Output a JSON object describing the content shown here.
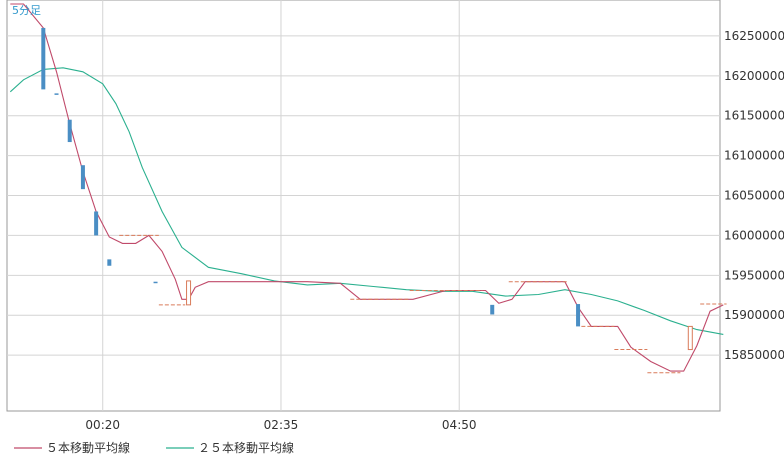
{
  "chart_data": {
    "type": "candlestick",
    "timeframe_label": "5分足",
    "y_ticks": [
      15850000,
      15900000,
      15950000,
      16000000,
      16050000,
      16100000,
      16150000,
      16200000,
      16250000
    ],
    "y_tick_labels": [
      "15850000",
      "15900000",
      "15950000",
      "16000000",
      "16050000",
      "16100000",
      "16150000",
      "16200000",
      "16250000"
    ],
    "ylim": [
      15780000,
      16295000
    ],
    "x_tick_labels": [
      "00:20",
      "02:35",
      "04:50"
    ],
    "x_tick_index": [
      14,
      41,
      68
    ],
    "bar_count": 108,
    "grid": true,
    "colors": {
      "down": "#4a8ec4",
      "up": "#d97b5a",
      "ma5": "#c04a6a",
      "ma25": "#2bb08f",
      "grid": "#d4d4d4",
      "axis": "#999999"
    },
    "candles": [
      {
        "i": 5,
        "open": 16260000,
        "high": 16260000,
        "close": 16183000,
        "low": 16183000
      },
      {
        "i": 7,
        "open": 16178000,
        "high": 16178000,
        "close": 16178000,
        "low": 16178000
      },
      {
        "i": 9,
        "open": 16145000,
        "high": 16145000,
        "close": 16117000,
        "low": 16117000
      },
      {
        "i": 11,
        "open": 16088000,
        "high": 16088000,
        "close": 16058000,
        "low": 16058000
      },
      {
        "i": 13,
        "open": 16030000,
        "high": 16030000,
        "close": 16000000,
        "low": 16000000
      },
      {
        "i": 15,
        "open": 15970000,
        "high": 15970000,
        "close": 15962000,
        "low": 15962000
      },
      {
        "i": 22,
        "open": 15942000,
        "high": 15942000,
        "close": 15942000,
        "low": 15942000
      },
      {
        "i": 27,
        "open": 15913000,
        "high": 15943000,
        "close": 15943000,
        "low": 15913000
      },
      {
        "i": 73,
        "open": 15913000,
        "high": 15913000,
        "close": 15901000,
        "low": 15901000
      },
      {
        "i": 86,
        "open": 15914000,
        "high": 15914000,
        "close": 15886000,
        "low": 15886000
      },
      {
        "i": 103,
        "open": 15857000,
        "high": 15886000,
        "close": 15886000,
        "low": 15857000
      }
    ],
    "flat_bars": [
      {
        "start": 17,
        "end": 22,
        "value": 16000000
      },
      {
        "start": 23,
        "end": 26,
        "value": 15913000
      },
      {
        "start": 52,
        "end": 60,
        "value": 15920000
      },
      {
        "start": 61,
        "end": 71,
        "value": 15931000
      },
      {
        "start": 76,
        "end": 84,
        "value": 15942000
      },
      {
        "start": 87,
        "end": 91,
        "value": 15886000
      },
      {
        "start": 92,
        "end": 96,
        "value": 15857000
      },
      {
        "start": 97,
        "end": 101,
        "value": 15828000
      },
      {
        "start": 105,
        "end": 108,
        "value": 15914000
      }
    ],
    "series": [
      {
        "name": "５本移動平均線",
        "points": [
          [
            0,
            16290000
          ],
          [
            2,
            16290000
          ],
          [
            5,
            16260000
          ],
          [
            7,
            16205000
          ],
          [
            9,
            16140000
          ],
          [
            11,
            16080000
          ],
          [
            13,
            16030000
          ],
          [
            15,
            15998000
          ],
          [
            17,
            15990000
          ],
          [
            19,
            15990000
          ],
          [
            21,
            16000000
          ],
          [
            23,
            15980000
          ],
          [
            25,
            15945000
          ],
          [
            26,
            15920000
          ],
          [
            27,
            15920000
          ],
          [
            28,
            15935000
          ],
          [
            30,
            15942000
          ],
          [
            45,
            15942000
          ],
          [
            50,
            15940000
          ],
          [
            53,
            15920000
          ],
          [
            55,
            15920000
          ],
          [
            58,
            15920000
          ],
          [
            61,
            15920000
          ],
          [
            66,
            15931000
          ],
          [
            72,
            15931000
          ],
          [
            74,
            15915000
          ],
          [
            76,
            15920000
          ],
          [
            78,
            15942000
          ],
          [
            84,
            15942000
          ],
          [
            86,
            15910000
          ],
          [
            88,
            15886000
          ],
          [
            92,
            15886000
          ],
          [
            94,
            15860000
          ],
          [
            97,
            15842000
          ],
          [
            100,
            15830000
          ],
          [
            102,
            15830000
          ],
          [
            104,
            15862000
          ],
          [
            106,
            15905000
          ],
          [
            108,
            15913000
          ]
        ]
      },
      {
        "name": "２５本移動平均線",
        "points": [
          [
            0,
            16180000
          ],
          [
            2,
            16195000
          ],
          [
            5,
            16208000
          ],
          [
            8,
            16210000
          ],
          [
            11,
            16205000
          ],
          [
            14,
            16190000
          ],
          [
            16,
            16165000
          ],
          [
            18,
            16130000
          ],
          [
            20,
            16085000
          ],
          [
            23,
            16030000
          ],
          [
            26,
            15985000
          ],
          [
            30,
            15960000
          ],
          [
            35,
            15952000
          ],
          [
            40,
            15943000
          ],
          [
            45,
            15938000
          ],
          [
            50,
            15940000
          ],
          [
            55,
            15936000
          ],
          [
            60,
            15932000
          ],
          [
            65,
            15930000
          ],
          [
            70,
            15930000
          ],
          [
            75,
            15924000
          ],
          [
            80,
            15926000
          ],
          [
            84,
            15932000
          ],
          [
            88,
            15926000
          ],
          [
            92,
            15918000
          ],
          [
            96,
            15906000
          ],
          [
            100,
            15893000
          ],
          [
            104,
            15882000
          ],
          [
            108,
            15876000
          ]
        ]
      }
    ]
  },
  "legend": [
    {
      "label": "５本移動平均線",
      "color": "#c04a6a"
    },
    {
      "label": "２５本移動平均線",
      "color": "#2bb08f"
    }
  ]
}
